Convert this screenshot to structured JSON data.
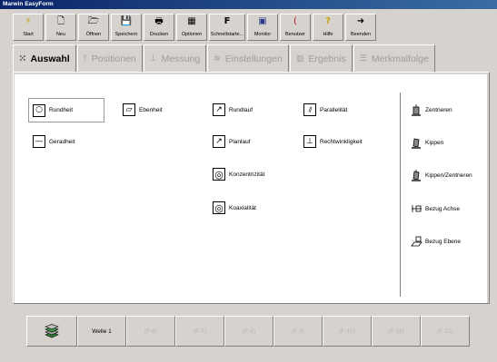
{
  "window": {
    "title": "Marwin EasyForm"
  },
  "toolbar": {
    "buttons": [
      {
        "label": "Start",
        "icon": "⚡"
      },
      {
        "label": "Neu",
        "icon": "🗋"
      },
      {
        "label": "Öffnen",
        "icon": "🗁"
      },
      {
        "label": "Speichern",
        "icon": "💾"
      },
      {
        "label": "Drucken",
        "icon": "🖶"
      },
      {
        "label": "Optionen",
        "icon": "▦"
      },
      {
        "label": "Schnellstarte...",
        "icon": "F"
      },
      {
        "label": "Monitor",
        "icon": "▣"
      },
      {
        "label": "Benutzer",
        "icon": "("
      },
      {
        "label": "Hilfe",
        "icon": "?"
      },
      {
        "label": "Beenden",
        "icon": "➜"
      }
    ]
  },
  "tabs": [
    {
      "label": "Auswahl",
      "icon": "⁙"
    },
    {
      "label": "Positionen",
      "icon": "⤒"
    },
    {
      "label": "Messung",
      "icon": "⊥"
    },
    {
      "label": "Einstellungen",
      "icon": "≋"
    },
    {
      "label": "Ergebnis",
      "icon": "▥"
    },
    {
      "label": "Merkmalfolge",
      "icon": "☰"
    }
  ],
  "features": {
    "rundheit": {
      "label": "Rundheit",
      "symbol": "○"
    },
    "ebenheit": {
      "label": "Ebenheit",
      "symbol": "▱"
    },
    "rundlauf": {
      "label": "Rundlauf",
      "symbol": "↗"
    },
    "parallelitaet": {
      "label": "Parallelität",
      "symbol": "∕∕"
    },
    "geradheit": {
      "label": "Geradheit",
      "symbol": "—"
    },
    "planlauf": {
      "label": "Planlauf",
      "symbol": "↗"
    },
    "rechtwinkligkeit": {
      "label": "Rechtwinkligkeit",
      "symbol": "⊥"
    },
    "konzentrizitaet": {
      "label": "Konzentrizität",
      "symbol": "◎"
    },
    "koaxialitaet": {
      "label": "Koaxialität",
      "symbol": "◎"
    }
  },
  "alignment": {
    "zentrieren": {
      "label": "Zentrieren"
    },
    "kippen": {
      "label": "Kippen"
    },
    "kippen_zentrieren": {
      "label": "Kippen/Zentrieren"
    },
    "bezug_achse": {
      "label": "Bezug Achse"
    },
    "bezug_ebene": {
      "label": "Bezug Ebene"
    }
  },
  "bottom": {
    "active_label": "Welle 1",
    "keys": [
      "(F-6)",
      "(F-7)",
      "(F-8)",
      "(F-9)",
      "(F-10)",
      "(F-11)",
      "(F-12)"
    ]
  }
}
